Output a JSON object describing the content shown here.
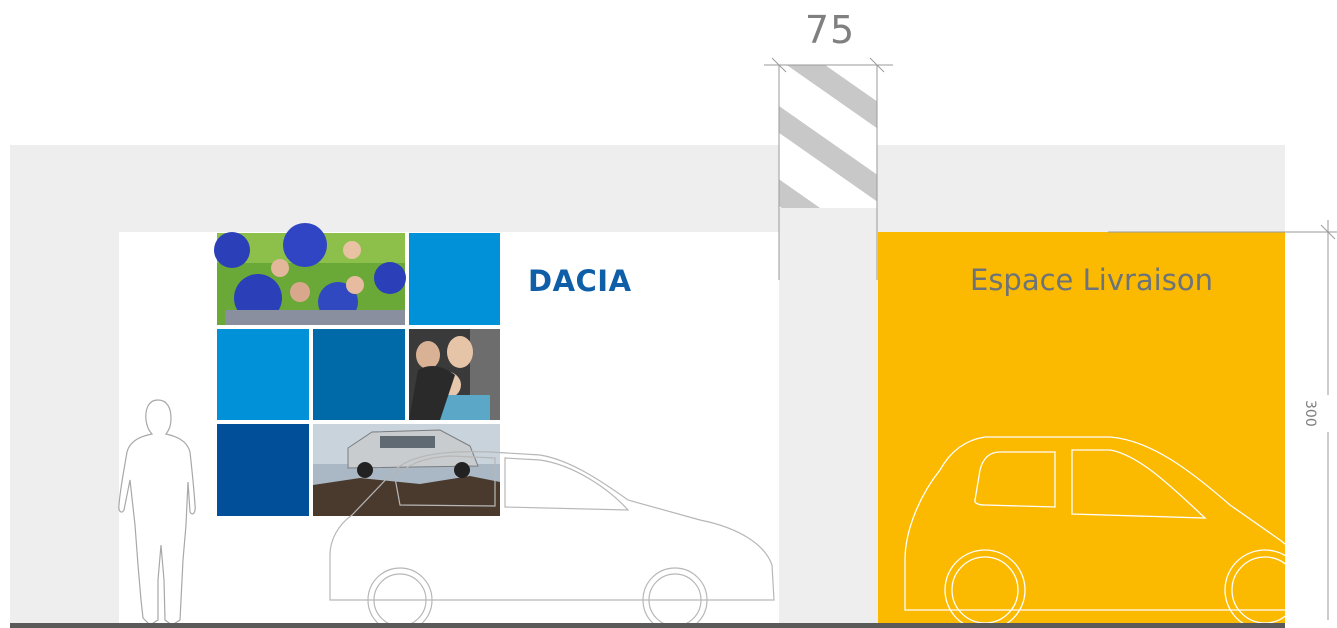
{
  "drawing": {
    "dimension_top": "75",
    "dimension_right": "300",
    "brand_logo": "DACIA",
    "zone_title": "Espace Livraison"
  },
  "colors": {
    "wall_gray": "#eeeeee",
    "delivery_yellow": "#fbb900",
    "blue_light": "#0091d9",
    "blue_mid": "#006aa9",
    "blue_dark": "#004f98",
    "hatch_gray": "#c8c8c8",
    "floor_gray": "#5a5a5a",
    "logo_blue": "#0f5ea8"
  },
  "icons": [
    "person-silhouette-icon",
    "car-outline-icon",
    "car-outline-icon"
  ]
}
